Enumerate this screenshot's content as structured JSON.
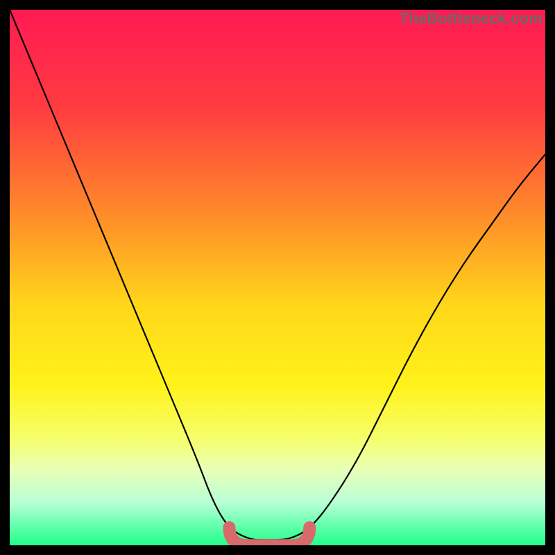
{
  "watermark": {
    "text": "TheBottleneck.com"
  },
  "colors": {
    "black": "#000000",
    "curve": "#000000",
    "flat_segment": "#d76a6a",
    "gradient_stops": [
      {
        "offset": 0.0,
        "color": "#ff1a53"
      },
      {
        "offset": 0.18,
        "color": "#ff3b41"
      },
      {
        "offset": 0.38,
        "color": "#ff8a2a"
      },
      {
        "offset": 0.55,
        "color": "#ffd61a"
      },
      {
        "offset": 0.7,
        "color": "#fff21a"
      },
      {
        "offset": 0.8,
        "color": "#f6ff6a"
      },
      {
        "offset": 0.86,
        "color": "#e8ffb8"
      },
      {
        "offset": 0.92,
        "color": "#b8ffd6"
      },
      {
        "offset": 0.96,
        "color": "#6affb0"
      },
      {
        "offset": 1.0,
        "color": "#22ff8a"
      }
    ]
  },
  "chart_data": {
    "type": "line",
    "title": "",
    "xlabel": "",
    "ylabel": "",
    "xlim": [
      0,
      100
    ],
    "ylim": [
      0,
      100
    ],
    "x": [
      0,
      5,
      10,
      15,
      20,
      25,
      30,
      35,
      38,
      41,
      45,
      48,
      52,
      56,
      60,
      65,
      70,
      75,
      80,
      85,
      90,
      95,
      100
    ],
    "series": [
      {
        "name": "bottleneck-curve",
        "values": [
          100,
          88,
          76,
          64,
          52,
          40,
          28,
          16,
          8,
          3,
          1,
          1,
          1,
          3,
          8,
          16,
          26,
          36,
          45,
          53,
          60,
          67,
          73
        ]
      }
    ],
    "annotations": [
      {
        "name": "optimal-flat-region",
        "x_start": 41,
        "x_end": 56,
        "y": 1
      }
    ]
  }
}
